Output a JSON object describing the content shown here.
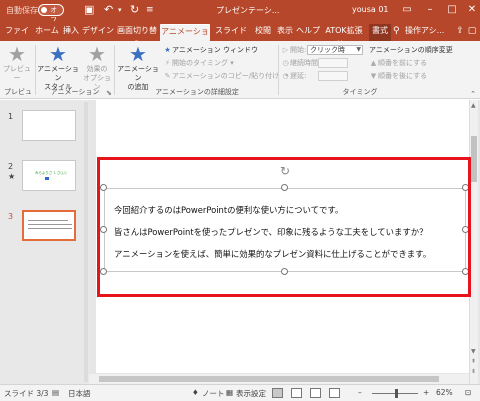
{
  "titlebar": {
    "autosave": "自動保存",
    "toggle": "オフ",
    "doc_title": "プレゼンテーシ...",
    "user": "yousa 01",
    "save_icon": "save-icon",
    "undo_icon": "undo-icon",
    "redo_icon": "redo-icon",
    "more_icon": "customize-icon"
  },
  "tabs": [
    "ファイル",
    "ホーム",
    "挿入",
    "デザイン",
    "画面切り替え",
    "アニメーション",
    "スライド ショー",
    "校閲",
    "表示",
    "ヘルプ",
    "ATOK拡張サ...",
    "書式",
    "操作アシ..."
  ],
  "ribbon": {
    "preview_label": "プレビュー",
    "preview_group": "プレビュー",
    "anim_style_line1": "アニメーション",
    "anim_style_line2": "スタイル",
    "effect_opt_line1": "効果の",
    "effect_opt_line2": "オプション",
    "anim_group": "アニメーション",
    "add_anim_line1": "アニメーション",
    "add_anim_line2": "の追加",
    "anim_window": "アニメーション ウィンドウ",
    "trigger": "開始のタイミング",
    "copy_paste": "アニメーションのコピー/貼り付け",
    "detail_group": "アニメーションの詳細設定",
    "start_label": "開始:",
    "start_value": "クリック時",
    "duration_label": "継続時間:",
    "delay_label": "遅延:",
    "reorder_title": "アニメーションの順序変更",
    "move_earlier": "順番を前にする",
    "move_later": "順番を後にする",
    "timing_group": "タイミング"
  },
  "slides": [
    {
      "num": "1"
    },
    {
      "num": "2",
      "star": "★",
      "thumb_text": "みらよりさ 1 さ(い)"
    },
    {
      "num": "3"
    }
  ],
  "slide_text": [
    "今回紹介するのはPowerPointの便利な使い方についてです。",
    "皆さんはPowerPointを使ったプレゼンで、印象に残るような工夫をしていますか？",
    "アニメーションを使えば、簡単に効果的なプレゼン資料に仕上げることができます。"
  ],
  "status": {
    "slide": "スライド 3/3",
    "lang": "日本語",
    "notes": "ノート",
    "display": "表示設定",
    "zoom": "62%"
  },
  "colors": {
    "accent": "#b7472a",
    "highlight": "#e8141c",
    "icon_blue": "#3a6fc2"
  }
}
